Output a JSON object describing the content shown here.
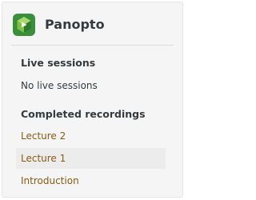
{
  "block": {
    "title": "Panopto",
    "logo_icon": "panopto-logo-icon",
    "brand_colors": {
      "logo_light": "#7fc243",
      "logo_dark": "#2d7a2e",
      "link": "#8b5a14"
    }
  },
  "live_sessions": {
    "heading": "Live sessions",
    "empty_text": "No live sessions"
  },
  "completed_recordings": {
    "heading": "Completed recordings",
    "items": [
      {
        "label": "Lecture 2"
      },
      {
        "label": "Lecture 1"
      },
      {
        "label": "Introduction"
      }
    ]
  }
}
